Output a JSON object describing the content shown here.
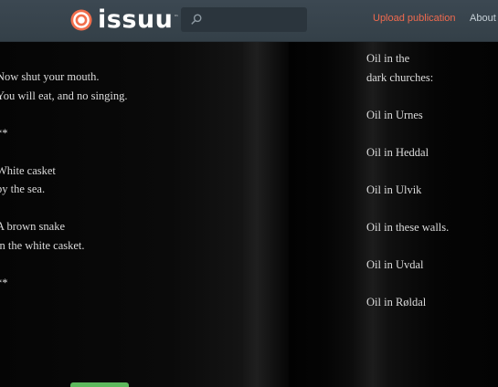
{
  "header": {
    "logo_text": "issuu",
    "logo_tm": "™",
    "search": {
      "placeholder": "",
      "value": ""
    },
    "nav": {
      "upload_label": "Upload publication",
      "about_label": "About"
    },
    "colors": {
      "brand": "#f26f4d",
      "upload_link": "#f06a4e",
      "header_bg": "#3a4650"
    }
  },
  "reader": {
    "left_page": {
      "lines": [
        "Now shut your mouth.",
        "You will eat, and no singing.",
        "",
        "**",
        "",
        "White casket",
        "by the sea.",
        "",
        "A brown snake",
        "in the white casket.",
        "",
        "**"
      ]
    },
    "right_page": {
      "lines": [
        "Oil in the",
        "dark churches:",
        "",
        "Oil in Urnes",
        "",
        "Oil in Heddal",
        "",
        "Oil in Ulvik",
        "",
        "Oil in these walls.",
        "",
        "Oil in Uvdal",
        "",
        "Oil in Røldal"
      ]
    },
    "button_color": "#5cb85c"
  }
}
